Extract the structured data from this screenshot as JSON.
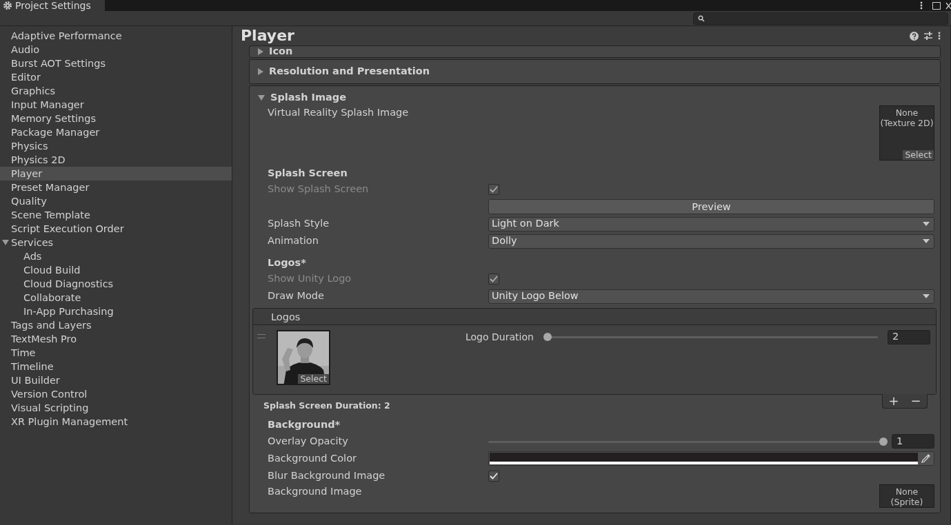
{
  "window": {
    "title": "Project Settings"
  },
  "sidebar": {
    "items": [
      {
        "label": "Adaptive Performance",
        "selected": false
      },
      {
        "label": "Audio",
        "selected": false
      },
      {
        "label": "Burst AOT Settings",
        "selected": false
      },
      {
        "label": "Editor",
        "selected": false
      },
      {
        "label": "Graphics",
        "selected": false
      },
      {
        "label": "Input Manager",
        "selected": false
      },
      {
        "label": "Memory Settings",
        "selected": false
      },
      {
        "label": "Package Manager",
        "selected": false
      },
      {
        "label": "Physics",
        "selected": false
      },
      {
        "label": "Physics 2D",
        "selected": false
      },
      {
        "label": "Player",
        "selected": true
      },
      {
        "label": "Preset Manager",
        "selected": false
      },
      {
        "label": "Quality",
        "selected": false
      },
      {
        "label": "Scene Template",
        "selected": false
      },
      {
        "label": "Script Execution Order",
        "selected": false
      },
      {
        "label": "Services",
        "selected": false,
        "expanded": true,
        "children": [
          {
            "label": "Ads",
            "selected": false
          },
          {
            "label": "Cloud Build",
            "selected": false
          },
          {
            "label": "Cloud Diagnostics",
            "selected": false
          },
          {
            "label": "Collaborate",
            "selected": false
          },
          {
            "label": "In-App Purchasing",
            "selected": false
          }
        ]
      },
      {
        "label": "Tags and Layers",
        "selected": false
      },
      {
        "label": "TextMesh Pro",
        "selected": false
      },
      {
        "label": "Time",
        "selected": false
      },
      {
        "label": "Timeline",
        "selected": false
      },
      {
        "label": "UI Builder",
        "selected": false
      },
      {
        "label": "Version Control",
        "selected": false
      },
      {
        "label": "Visual Scripting",
        "selected": false
      },
      {
        "label": "XR Plugin Management",
        "selected": false
      }
    ]
  },
  "page": {
    "title": "Player"
  },
  "sections": [
    {
      "label": "Icon",
      "expanded": false
    },
    {
      "label": "Resolution and Presentation",
      "expanded": false
    },
    {
      "label": "Splash Image",
      "expanded": true,
      "rows": [
        {
          "kind": "object",
          "label": "Virtual Reality Splash Image",
          "value": [
            "None",
            "(Texture 2D)"
          ],
          "button": "Select"
        },
        {
          "kind": "heading",
          "label": "Splash Screen"
        },
        {
          "kind": "checkbox",
          "label": "Show Splash Screen",
          "checked": true,
          "disabled": true
        },
        {
          "kind": "button",
          "label": "Preview"
        },
        {
          "kind": "dropdown",
          "label": "Splash Style",
          "value": "Light on Dark"
        },
        {
          "kind": "dropdown",
          "label": "Animation",
          "value": "Dolly"
        },
        {
          "kind": "heading",
          "label": "Logos*"
        },
        {
          "kind": "checkbox",
          "label": "Show Unity Logo",
          "checked": true,
          "disabled": true
        },
        {
          "kind": "dropdown",
          "label": "Draw Mode",
          "value": "Unity Logo Below"
        },
        {
          "kind": "logos",
          "label": "Logos",
          "items": [
            {
              "button": "Select",
              "slider_label": "Logo Duration",
              "level": 0,
              "value": "2"
            }
          ],
          "note": "Splash Screen Duration: 2",
          "add": "+",
          "remove": "−"
        },
        {
          "kind": "heading",
          "label": "Background*"
        },
        {
          "kind": "slider",
          "label": "Overlay Opacity",
          "level": 1,
          "value": "1"
        },
        {
          "kind": "color",
          "label": "Background Color",
          "color": "#231f20"
        },
        {
          "kind": "checkbox",
          "label": "Blur Background Image",
          "checked": true,
          "disabled": false
        },
        {
          "kind": "object",
          "label": "Background Image",
          "value": [
            "None",
            "(Sprite)"
          ]
        }
      ]
    }
  ]
}
